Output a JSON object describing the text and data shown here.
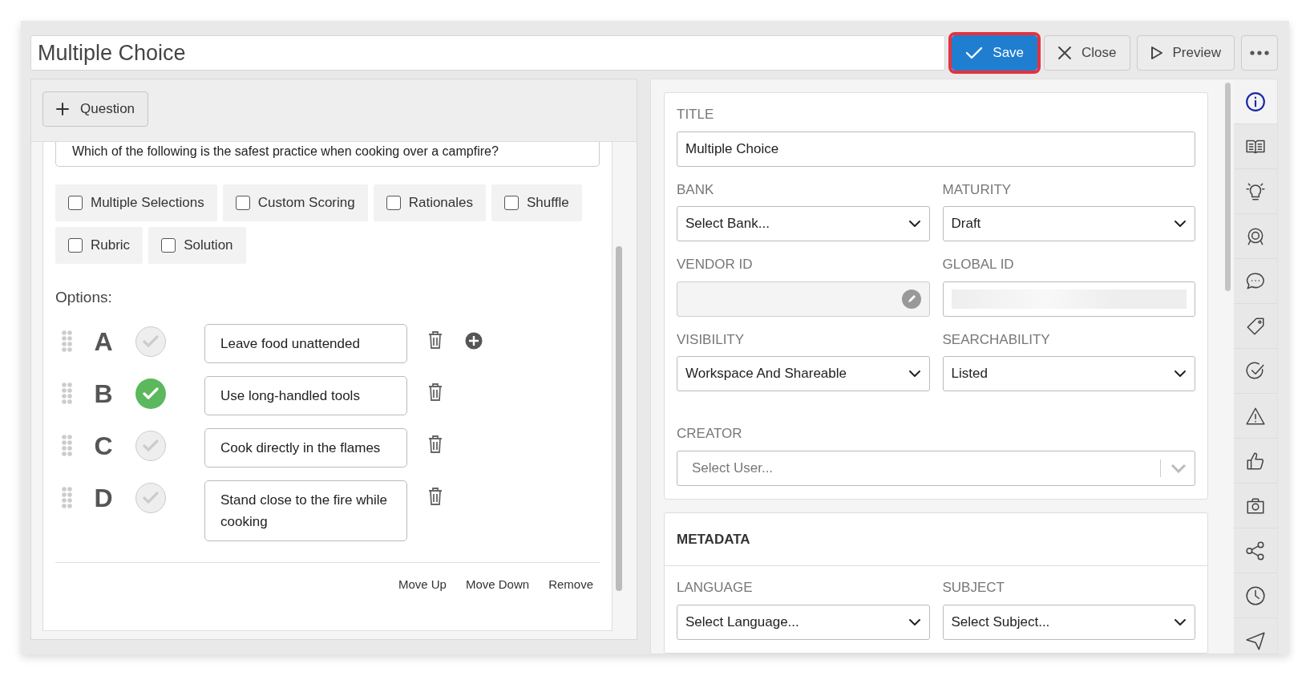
{
  "title_field": {
    "value": "Multiple Choice"
  },
  "toolbar": [
    {
      "kind": "save",
      "label": "Save",
      "highlighted": true
    },
    {
      "kind": "close",
      "label": "Close",
      "highlighted": false
    },
    {
      "kind": "preview",
      "label": "Preview",
      "highlighted": false
    },
    {
      "kind": "more",
      "highlighted": false
    }
  ],
  "question_panel": {
    "add_button": "Question",
    "question_text": "Which of the following is the safest practice when cooking over a campfire?",
    "settings": [
      {
        "label": "Multiple Selections",
        "checked": false
      },
      {
        "label": "Custom Scoring",
        "checked": false
      },
      {
        "label": "Rationales",
        "checked": false
      },
      {
        "label": "Shuffle",
        "checked": false
      },
      {
        "label": "Rubric",
        "checked": false
      },
      {
        "label": "Solution",
        "checked": false
      }
    ],
    "options_label": "Options:",
    "options": [
      {
        "letter": "A",
        "text": "Leave food unattended",
        "correct": false,
        "show_add": true
      },
      {
        "letter": "B",
        "text": "Use long-handled tools",
        "correct": true,
        "show_add": false
      },
      {
        "letter": "C",
        "text": "Cook directly in the flames",
        "correct": false,
        "show_add": false
      },
      {
        "letter": "D",
        "text": "Stand close to the fire while cooking",
        "correct": false,
        "show_add": false
      }
    ],
    "actions": [
      "Move Up",
      "Move Down",
      "Remove"
    ]
  },
  "details": {
    "rows": [
      [
        {
          "label": "TITLE",
          "kind": "text",
          "value": "Multiple Choice"
        }
      ],
      [
        {
          "label": "BANK",
          "kind": "select",
          "value": "Select Bank..."
        },
        {
          "label": "MATURITY",
          "kind": "select",
          "value": "Draft"
        }
      ],
      [
        {
          "label": "VENDOR ID",
          "kind": "readonly"
        },
        {
          "label": "GLOBAL ID",
          "kind": "loading"
        }
      ],
      [
        {
          "label": "VISIBILITY",
          "kind": "select",
          "value": "Workspace And Shareable"
        },
        {
          "label": "SEARCHABILITY",
          "kind": "select",
          "value": "Listed"
        }
      ],
      [
        {
          "label": "CREATOR",
          "kind": "combobox",
          "placeholder": "Select User..."
        }
      ]
    ]
  },
  "metadata": {
    "heading": "METADATA",
    "rows": [
      [
        {
          "label": "LANGUAGE",
          "kind": "select",
          "value": "Select Language..."
        },
        {
          "label": "SUBJECT",
          "kind": "select",
          "value": "Select Subject..."
        }
      ]
    ]
  },
  "sidebar": {
    "items": [
      {
        "selected": true
      },
      {
        "selected": false
      },
      {
        "selected": false
      },
      {
        "selected": false
      },
      {
        "selected": false
      },
      {
        "selected": false
      },
      {
        "selected": false
      },
      {
        "selected": false
      },
      {
        "selected": false
      },
      {
        "selected": false
      },
      {
        "selected": false
      },
      {
        "selected": false
      },
      {
        "selected": false
      }
    ]
  }
}
